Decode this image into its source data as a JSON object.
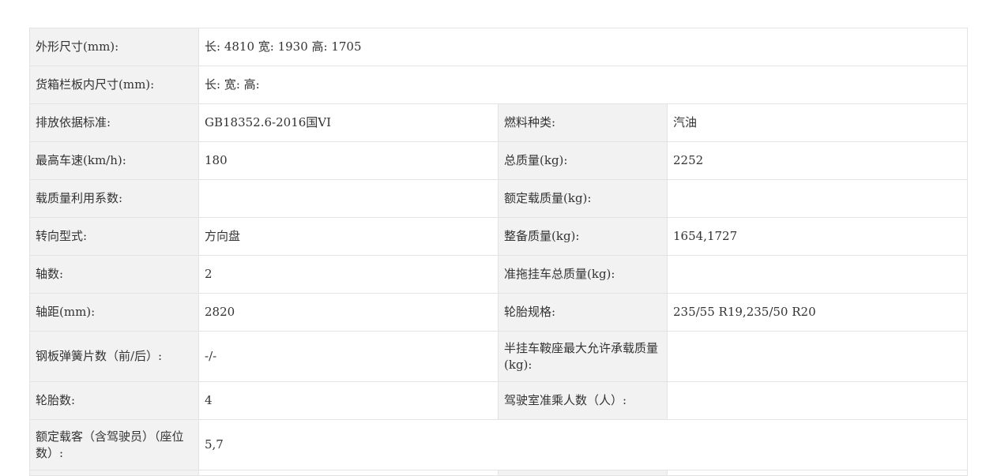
{
  "rows": [
    {
      "l1": "外形尺寸(mm):",
      "v1": "长: 4810 宽: 1930 高: 1705"
    },
    {
      "l1": "货箱栏板内尺寸(mm):",
      "v1": "长:  宽:  高:"
    },
    {
      "l1": "排放依据标准:",
      "v1": "GB18352.6-2016国VI",
      "l2": "燃料种类:",
      "v2": "汽油"
    },
    {
      "l1": "最高车速(km/h):",
      "v1": "180",
      "l2": "总质量(kg):",
      "v2": "2252"
    },
    {
      "l1": "载质量利用系数:",
      "v1": "",
      "l2": "额定载质量(kg):",
      "v2": ""
    },
    {
      "l1": "转向型式:",
      "v1": "方向盘",
      "l2": "整备质量(kg):",
      "v2": "1654,1727"
    },
    {
      "l1": "轴数:",
      "v1": "2",
      "l2": "准拖挂车总质量(kg):",
      "v2": ""
    },
    {
      "l1": "轴距(mm):",
      "v1": "2820",
      "l2": "轮胎规格:",
      "v2": "235/55 R19,235/50 R20"
    },
    {
      "l1": "钢板弹簧片数（前/后）:",
      "v1": "-/-",
      "l2": "半挂车鞍座最大允许承载质量(kg):",
      "v2": ""
    },
    {
      "l1": "轮胎数:",
      "v1": "4",
      "l2": "驾驶室准乘人数（人）:",
      "v2": ""
    },
    {
      "l1": "额定载客（含驾驶员）（座位数）:",
      "v1": "5,7"
    }
  ]
}
